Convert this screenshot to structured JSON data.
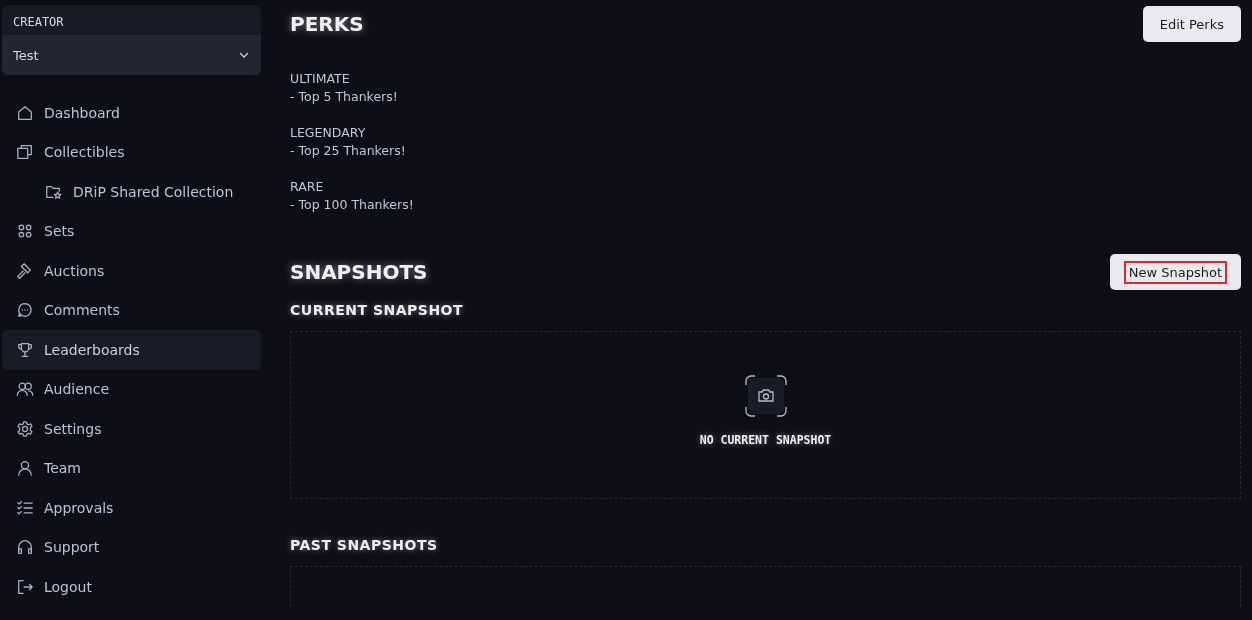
{
  "sidebar": {
    "creator": {
      "label": "CREATOR",
      "value": "Test"
    },
    "items": [
      {
        "label": "Dashboard",
        "kind": "home",
        "selected": false
      },
      {
        "label": "Collectibles",
        "kind": "cards",
        "selected": false,
        "children": [
          {
            "label": "DRiP Shared Collection",
            "kind": "folder-star",
            "selected": false
          }
        ]
      },
      {
        "label": "Sets",
        "kind": "grid",
        "selected": false
      },
      {
        "label": "Auctions",
        "kind": "gavel",
        "selected": false
      },
      {
        "label": "Comments",
        "kind": "chat",
        "selected": false
      },
      {
        "label": "Leaderboards",
        "kind": "trophy",
        "selected": true
      },
      {
        "label": "Audience",
        "kind": "people",
        "selected": false
      },
      {
        "label": "Settings",
        "kind": "gear",
        "selected": false
      },
      {
        "label": "Team",
        "kind": "person",
        "selected": false
      },
      {
        "label": "Approvals",
        "kind": "checklist",
        "selected": false
      },
      {
        "label": "Support",
        "kind": "headphones",
        "selected": false
      },
      {
        "label": "Logout",
        "kind": "logout",
        "selected": false
      }
    ]
  },
  "perks": {
    "title": "PERKS",
    "button": {
      "label": "Edit Perks",
      "highlighted": false
    },
    "tiers": [
      {
        "name": "ULTIMATE",
        "perk": "- Top 5 Thankers!"
      },
      {
        "name": "LEGENDARY",
        "perk": "- Top 25 Thankers!"
      },
      {
        "name": "RARE",
        "perk": "- Top 100 Thankers!"
      }
    ]
  },
  "snapshots": {
    "title": "SNAPSHOTS",
    "button": {
      "label": "New Snapshot",
      "highlighted": true
    },
    "current": {
      "title": "CURRENT SNAPSHOT",
      "empty_text": "NO CURRENT SNAPSHOT"
    },
    "past": {
      "title": "PAST SNAPSHOTS"
    }
  }
}
